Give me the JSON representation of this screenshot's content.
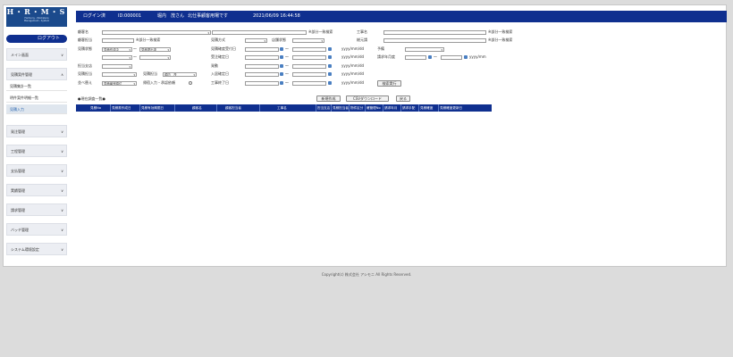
{
  "logo": {
    "title": "H・R・M・S",
    "sub1": "Harmony・Workplace",
    "sub2": "Management・System"
  },
  "header": {
    "login": "ログイン済",
    "id": "ID:000001",
    "user": "堀内　茂さん",
    "dept": "北仕事顧客用場です",
    "datetime": "2021/06/09 16:44:58"
  },
  "sidebar": {
    "logout": "ログアウト",
    "main_menu": "メイン画面",
    "case_mgmt": "見積案件管理",
    "sub_items": [
      "見積集計一覧",
      "明件案件明細一覧",
      "見積入力"
    ],
    "items": [
      "発注管理",
      "工程管理",
      "支払管理",
      "実績管理",
      "請求管理",
      "バッチ管理",
      "システム環境設定"
    ]
  },
  "form": {
    "customer": "顧客名",
    "customer_group": "顧客担当",
    "estimate_status": "見積状態",
    "sales_rep": "担当支店",
    "estimate_rep": "見積担当",
    "sort": "並べ替え",
    "partial_match": "※部分一致検索",
    "partial_match2": "※部分一致検索",
    "construction_name": "工事名",
    "contractor": "総元請",
    "partial_match3": "※部分一致検索",
    "partial_match4": "※部分一致検索",
    "estimate_method": "見積方式",
    "issue_status": "店舗状態",
    "estimate_date": "見積確度受付日",
    "order_date": "受注確定日",
    "reason": "発動",
    "delivery_date": "入居確定日",
    "completion_date": "工事終了日",
    "budget": "予備",
    "billing_month": "請求年月度",
    "status_a": "見積作成中",
    "status_b": "見積提出済",
    "rep_label": "見積担当",
    "rep_value": "堀内　茂",
    "sort_value": "見積番号順位",
    "only_estimate": "帰宿入力・承認依頼",
    "date_hint": "yyyy/mm/dd",
    "month_hint": "yyyy/mm",
    "tilde": "～",
    "search_button": "検索実行"
  },
  "list": {
    "title": "●現在調査一覧●",
    "new_button": "新規作成",
    "csv_button": "CSVダウンロード",
    "back_button": "戻る",
    "columns": [
      "見積No",
      "見積書作成日",
      "見積有効期限日",
      "顧客名",
      "顧客担当者",
      "工事名",
      "担当支店",
      "見積担当者",
      "物件区分",
      "確管理No",
      "請求年月",
      "請求手配",
      "見積確度",
      "見積確度更新日"
    ]
  },
  "footer": {
    "copyright": "Copyright(c) 株式会社 アシモニ All Rights Reserved."
  }
}
